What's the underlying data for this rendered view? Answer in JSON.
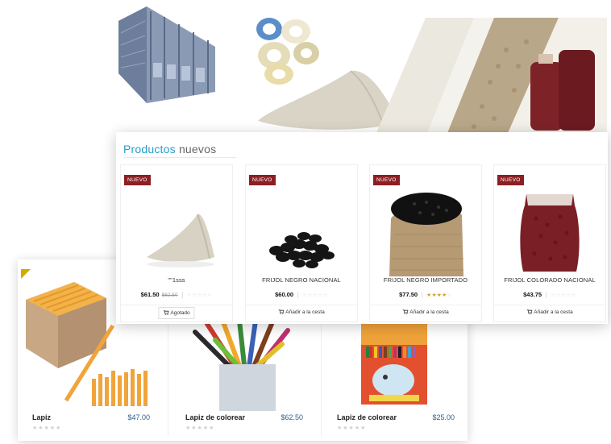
{
  "front": {
    "title_part1": "Productos",
    "title_part2": "nuevos",
    "products": [
      {
        "badge": "NUEVO",
        "name": "\"\"1sss",
        "price": "$61.50",
        "old_price": "$62.50",
        "stars": 0,
        "button": "Agotado"
      },
      {
        "badge": "NUEVO",
        "name": "FRIJOL NEGRO NACIONAL",
        "price": "$60.00",
        "stars": 0,
        "button": "Añadir a la cesta"
      },
      {
        "badge": "NUEVO",
        "name": "FRIJOL NEGRO IMPORTADO",
        "price": "$77.50",
        "stars": 4,
        "button": "Añadir a la cesta"
      },
      {
        "badge": "NUEVO",
        "name": "FRIJOL COLORADO NACIONAL",
        "price": "$43.75",
        "stars": 0,
        "button": "Añadir a la cesta"
      }
    ]
  },
  "back": {
    "items": [
      {
        "name": "Lapiz",
        "price": "$47.00",
        "stars": 0
      },
      {
        "name": "Lapiz de colorear",
        "price": "$62.50",
        "stars": 0
      },
      {
        "name": "Lapiz de colorear",
        "price": "$25.00",
        "stars": 0
      }
    ]
  },
  "colors": {
    "accent": "#2a9fc6",
    "badge": "#8b1f23",
    "price_link": "#2f5f88",
    "star_on": "#caa11f"
  }
}
